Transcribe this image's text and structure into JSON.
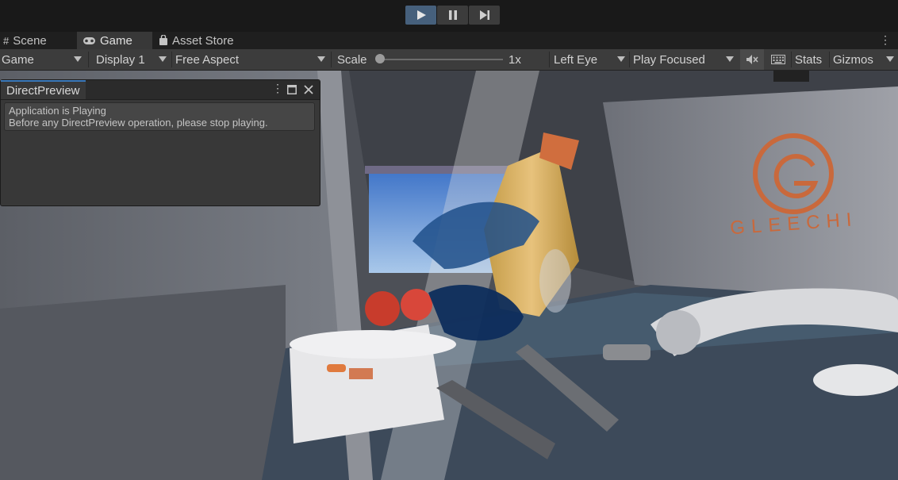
{
  "playbar": {
    "play": "play-icon",
    "pause": "pause-icon",
    "step": "step-icon",
    "active_color": "#46607c"
  },
  "tabs": [
    {
      "label": "Scene",
      "icon": "grid-icon"
    },
    {
      "label": "Game",
      "icon": "gamepad-icon"
    },
    {
      "label": "Asset Store",
      "icon": "bag-icon"
    }
  ],
  "toolbar": {
    "mode": "Game",
    "display": "Display 1",
    "aspect": "Free Aspect",
    "scale_label": "Scale",
    "scale_value": "1x",
    "eye": "Left Eye",
    "play_mode": "Play Focused",
    "mute": "mute-icon",
    "stats": "Stats",
    "gizmos": "Gizmos"
  },
  "panel": {
    "title": "DirectPreview",
    "help_line1": "Application is Playing",
    "help_line2": "Before any DirectPreview operation, please stop playing."
  },
  "scene": {
    "brand": "GLEECHI",
    "accent": "#c9693c"
  }
}
